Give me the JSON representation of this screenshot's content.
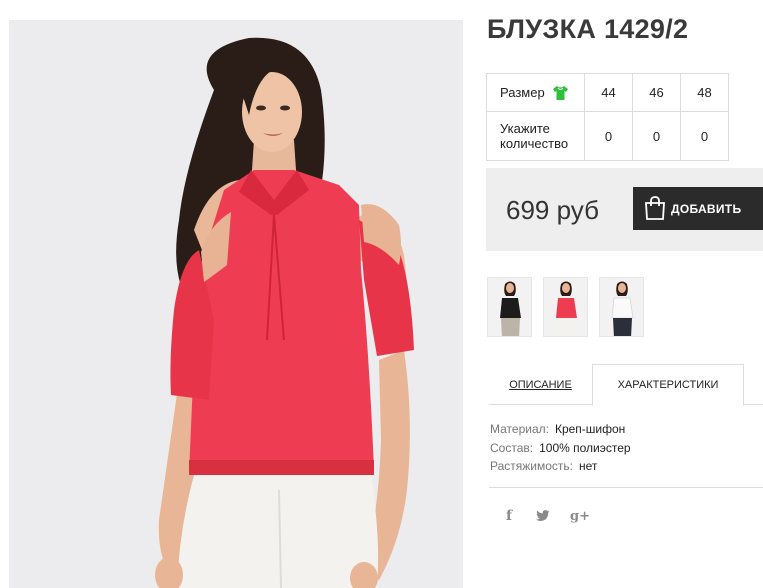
{
  "product": {
    "title": "БЛУЗКА 1429/2",
    "main_image_alt": "Блузка 1429/2 — красная"
  },
  "size_table": {
    "size_label": "Размер",
    "sizes": [
      "44",
      "46",
      "48"
    ],
    "quantity_label_line1": "Укажите",
    "quantity_label_line2": "количество",
    "quantities": [
      "0",
      "0",
      "0"
    ],
    "size_icon": "shirt-icon",
    "size_icon_color": "#2fbf3a"
  },
  "purchase": {
    "price": "699 руб",
    "add_button_label": "ДОБАВИТЬ",
    "button_color": "#2b2b2b"
  },
  "thumbnails": [
    {
      "color_name": "black",
      "blouse_color": "#1c1c1c"
    },
    {
      "color_name": "red",
      "blouse_color": "#ee3d52"
    },
    {
      "color_name": "white",
      "blouse_color": "#f6f6f6"
    }
  ],
  "tabs": [
    {
      "label": "ОПИСАНИЕ",
      "active": false
    },
    {
      "label": "ХАРАКТЕРИСТИКИ",
      "active": true
    }
  ],
  "specs": [
    {
      "key": "Материал:",
      "value": "Креп-шифон"
    },
    {
      "key": "Состав:",
      "value": "100% полиэстер"
    },
    {
      "key": "Растяжимость:",
      "value": "нет"
    }
  ],
  "social": [
    {
      "name": "facebook",
      "glyph": "f"
    },
    {
      "name": "twitter",
      "glyph": "t"
    },
    {
      "name": "google-plus",
      "glyph": "g+"
    }
  ],
  "colors": {
    "blouse": "#ee3d52",
    "accent_green": "#2fbf3a"
  }
}
